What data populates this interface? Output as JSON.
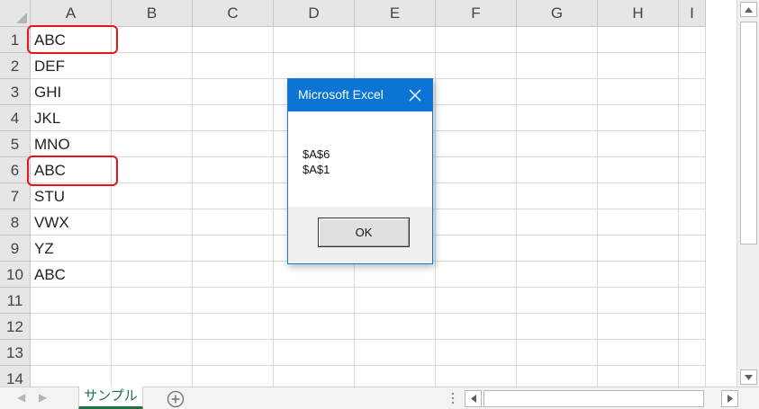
{
  "sheet": {
    "columns": [
      "A",
      "B",
      "C",
      "D",
      "E",
      "F",
      "G",
      "H",
      "I"
    ],
    "rows": [
      "1",
      "2",
      "3",
      "4",
      "5",
      "6",
      "7",
      "8",
      "9",
      "10",
      "11",
      "12",
      "13",
      "14"
    ],
    "column_a_values": [
      "ABC",
      "DEF",
      "GHI",
      "JKL",
      "MNO",
      "ABC",
      "STU",
      "VWX",
      "YZ",
      "ABC",
      "",
      "",
      "",
      ""
    ],
    "highlighted_cells": [
      "A1",
      "A6"
    ]
  },
  "tabs": {
    "active_sheet": "サンプル",
    "add_sheet_icon": "plus-circle-icon"
  },
  "dialog": {
    "title": "Microsoft Excel",
    "lines": [
      "$A$6",
      "$A$1"
    ],
    "ok_label": "OK"
  },
  "colors": {
    "highlight": "#e8141a",
    "title_bar": "#0c74d5",
    "sheet_tab_accent": "#217346"
  }
}
